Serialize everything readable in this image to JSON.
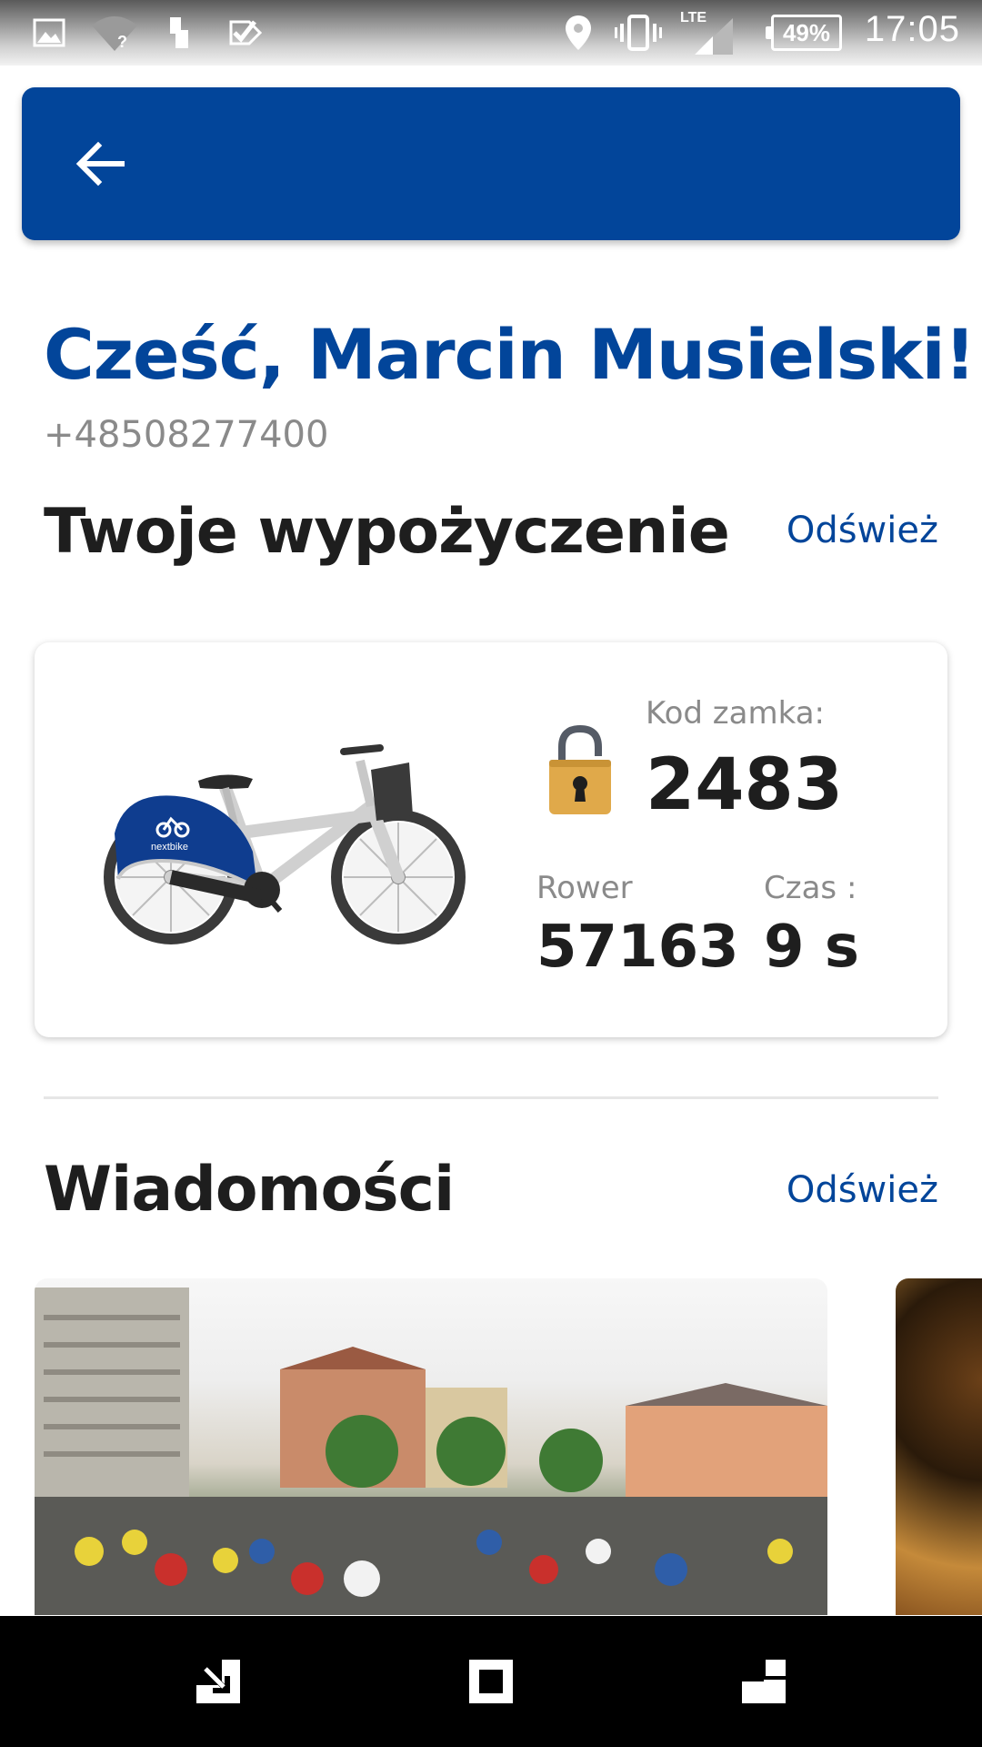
{
  "status_bar": {
    "network": "LTE",
    "battery": "49%",
    "time": "17:05",
    "icons": [
      "image-icon",
      "wifi-question-icon",
      "sim-icon",
      "check-icon",
      "location-icon",
      "vibrate-icon",
      "signal-icon",
      "battery-icon"
    ]
  },
  "app_bar": {
    "back_icon": "arrow-back-icon"
  },
  "greeting": {
    "title": "Cześć, Marcin Musielski!",
    "phone": "+48508277400"
  },
  "rental": {
    "title": "Twoje wypożyczenie",
    "refresh": "Odśwież",
    "bike_logo": "nextbike",
    "lock_code_label": "Kod zamka:",
    "lock_code": "2483",
    "bike_label": "Rower",
    "bike_number": "57163",
    "time_label": "Czas :",
    "time_value": "9 s",
    "colors": {
      "accent": "#02459a",
      "lock": "#e0a94a"
    }
  },
  "news": {
    "title": "Wiadomości",
    "refresh": "Odśwież"
  },
  "nav_bar": {
    "icons": [
      "back-nav-icon",
      "home-nav-icon",
      "recents-nav-icon"
    ]
  }
}
